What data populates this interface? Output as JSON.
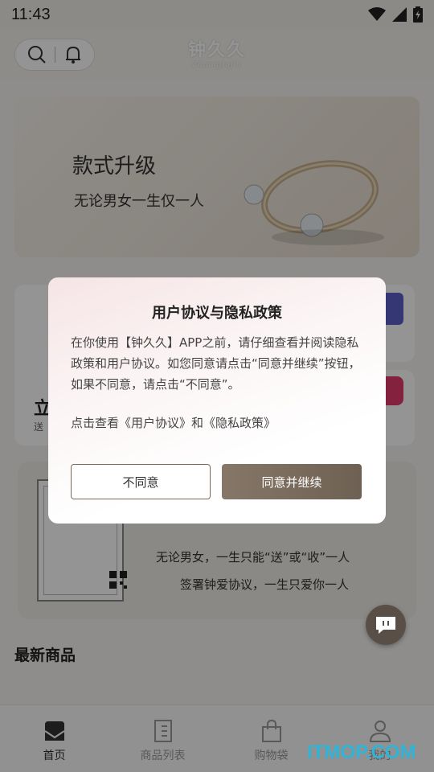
{
  "status_bar": {
    "time": "11:43"
  },
  "header": {
    "logo_cn": "钟久久",
    "logo_en": "ZhongJiuJiu"
  },
  "banner": {
    "title": "款式升级",
    "subtitle": "无论男女一生仅一人"
  },
  "feature": {
    "left_title": "立",
    "left_sub": "送"
  },
  "agreement": {
    "line1": "无论男女，一生只能“送”或“收”一人",
    "line2": "签署钟爱协议，一生只爱你一人"
  },
  "latest": {
    "title": "最新商品"
  },
  "nav": {
    "items": [
      {
        "label": "首页",
        "icon": "home-icon"
      },
      {
        "label": "商品列表",
        "icon": "list-icon"
      },
      {
        "label": "购物袋",
        "icon": "bag-icon"
      },
      {
        "label": "我的",
        "icon": "user-icon"
      }
    ]
  },
  "watermark": "ITMOP.COM",
  "dialog": {
    "title": "用户协议与隐私政策",
    "body": "在你使用【钟久久】APP之前，请仔细查看并阅读隐私政策和用户协议。如您同意请点击“同意并继续”按钮，如果不同意，请点击“不同意”。",
    "links_prefix": "点击查看",
    "user_agreement": "《用户协议》",
    "links_and": "和",
    "privacy_policy": "《隐私政策》",
    "disagree_label": "不同意",
    "agree_label": "同意并继续"
  },
  "colors": {
    "accent": "#7b6a5c",
    "watermark": "#2fb3d6"
  }
}
